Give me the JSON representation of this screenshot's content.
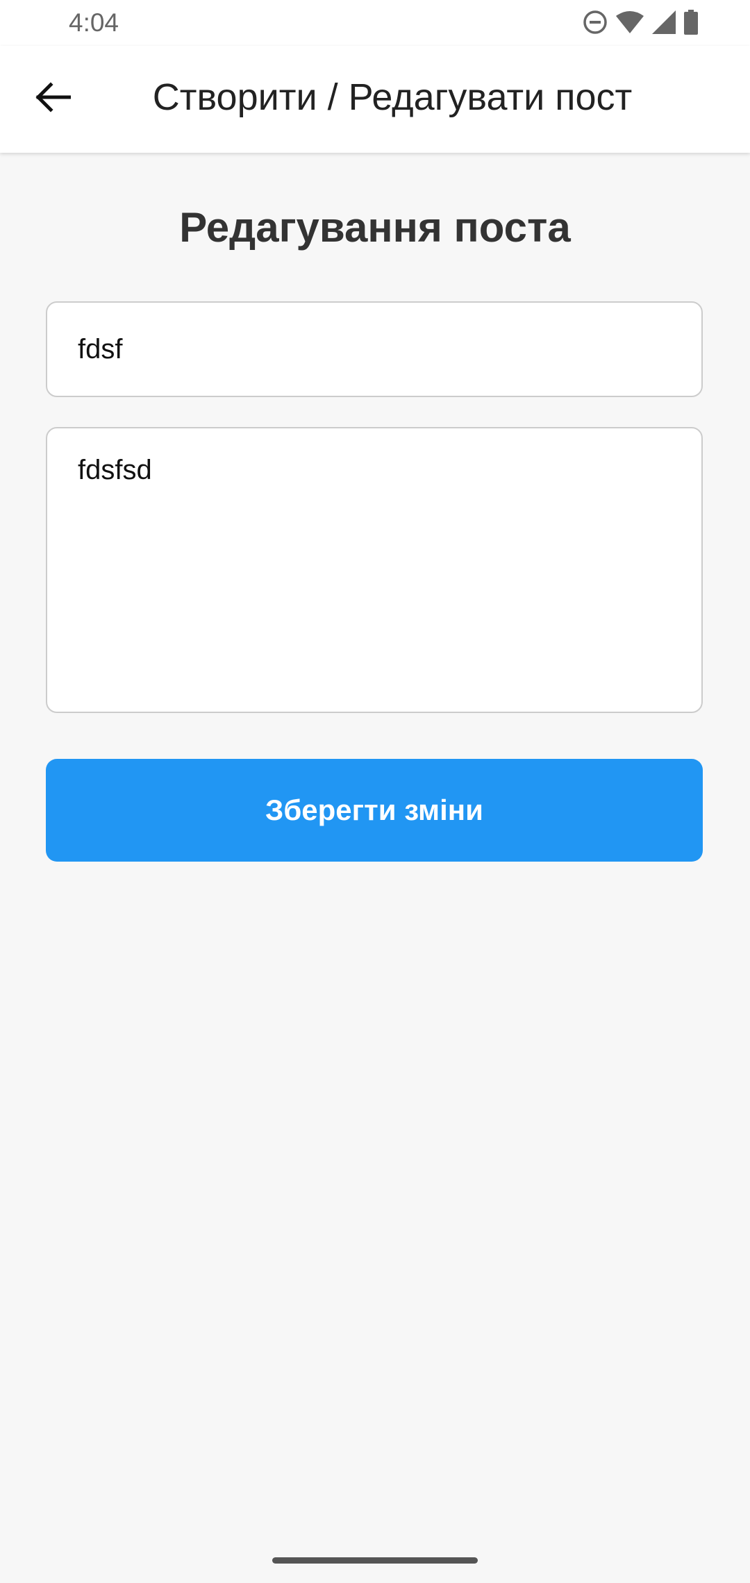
{
  "status_bar": {
    "time": "4:04",
    "icons": [
      "do-not-disturb-icon",
      "wifi-icon",
      "cellular-signal-icon",
      "battery-icon"
    ]
  },
  "app_bar": {
    "back_icon": "arrow-left-icon",
    "title": "Створити / Редагувати пост"
  },
  "form": {
    "heading": "Редагування поста",
    "title_value": "fdsf",
    "content_value": "fdsfsd",
    "save_label": "Зберегти зміни"
  },
  "colors": {
    "accent": "#2196f3",
    "background": "#f7f7f7",
    "surface": "#ffffff"
  }
}
